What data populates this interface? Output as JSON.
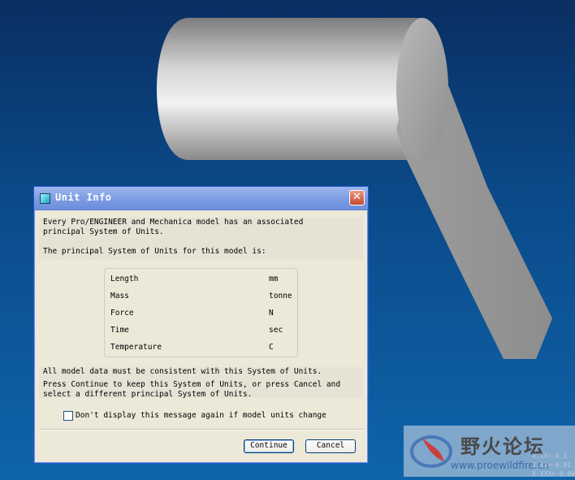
{
  "dialog": {
    "title": "Unit Info",
    "intro_line1": "Every Pro/ENGINEER and Mechanica model has an associated",
    "intro_line2": "principal System of Units.",
    "principal_line": "The principal System of Units for this model is:",
    "units": [
      {
        "name": "Length",
        "value": "mm"
      },
      {
        "name": "Mass",
        "value": "tonne"
      },
      {
        "name": "Force",
        "value": "N"
      },
      {
        "name": "Time",
        "value": "sec"
      },
      {
        "name": "Temperature",
        "value": "C"
      }
    ],
    "consistency_line": "All model data must be consistent with this System of Units.",
    "instruction_line1": "Press Continue to keep this System of Units, or press Cancel and",
    "instruction_line2": "select a different principal System of Units.",
    "checkbox_label": "Don't display this message again if model units change",
    "continue_label": "Continue",
    "cancel_label": "Cancel",
    "close_glyph": "✕"
  },
  "watermark": {
    "title": "野火论坛",
    "url": "www.proewildfire.cn"
  },
  "axis_readouts": [
    "X.XX+-0.1",
    "X.XX+-0.01",
    "X.XXX+-0.001"
  ],
  "colors": {
    "background_top": "#0a2f63",
    "background_bottom": "#0f64aa",
    "titlebar": "#7f9ee4",
    "dialog_face": "#ece9d8",
    "model_grey": "#8c8c8c"
  }
}
